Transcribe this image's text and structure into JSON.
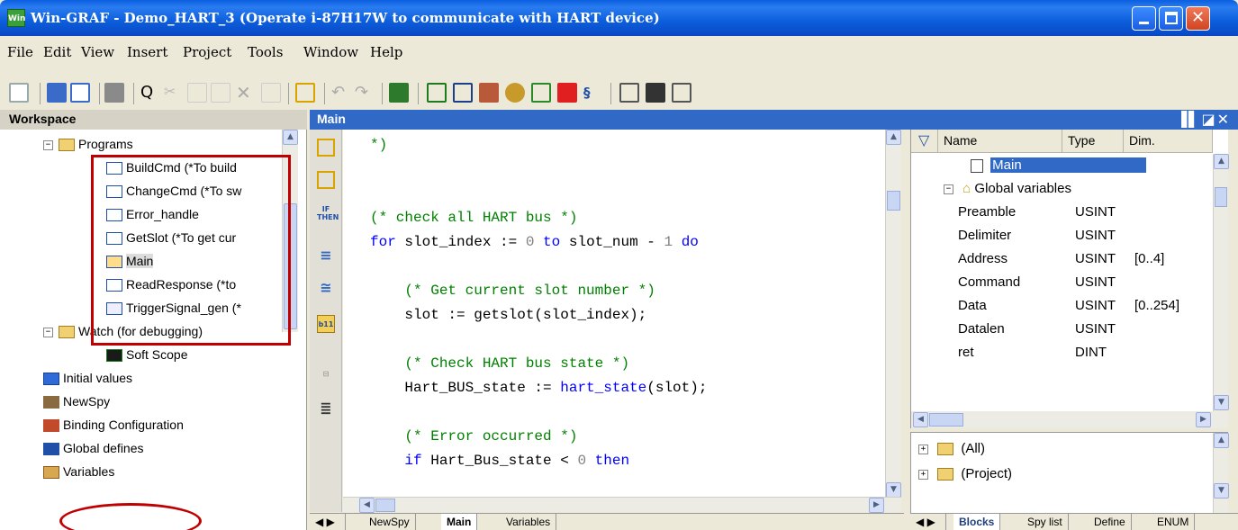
{
  "window": {
    "title": "Win-GRAF   - Demo_HART_3 (Operate i-87H17W to communicate with HART device)",
    "app_icon_label": "Win"
  },
  "menu": [
    "File",
    "Edit",
    "View",
    "Insert",
    "Project",
    "Tools",
    "Window",
    "Help"
  ],
  "workspace": {
    "title": "Workspace",
    "items": [
      {
        "label": "Programs",
        "type": "folder",
        "level": 1
      },
      {
        "label": "BuildCmd (*To build",
        "type": "program",
        "level": 2
      },
      {
        "label": "ChangeCmd (*To sw",
        "type": "program",
        "level": 2
      },
      {
        "label": "Error_handle",
        "type": "program",
        "level": 2
      },
      {
        "label": "GetSlot (*To get cur",
        "type": "program",
        "level": 2
      },
      {
        "label": "Main",
        "type": "st-main",
        "level": 2
      },
      {
        "label": "ReadResponse (*to",
        "type": "program",
        "level": 2
      },
      {
        "label": "TriggerSignal_gen (*",
        "type": "st",
        "level": 2
      },
      {
        "label": "Watch (for debugging)",
        "type": "folder",
        "level": 1
      },
      {
        "label": "Soft Scope",
        "type": "scope",
        "level": 2
      },
      {
        "label": "Initial values",
        "type": "table",
        "level": 1
      },
      {
        "label": "NewSpy",
        "type": "spy",
        "level": 1
      },
      {
        "label": "Binding Configuration",
        "type": "binding",
        "level": 1
      },
      {
        "label": "Global defines",
        "type": "defines",
        "level": 1
      },
      {
        "label": "Variables",
        "type": "variables",
        "level": 1
      }
    ]
  },
  "editor": {
    "title": "Main",
    "header_icons": "▐▌◪✕",
    "code": [
      {
        "parts": [
          {
            "t": "*)",
            "c": "cm"
          }
        ]
      },
      {
        "parts": []
      },
      {
        "parts": []
      },
      {
        "parts": [
          {
            "t": "(* check all HART bus *)",
            "c": "cm"
          }
        ]
      },
      {
        "parts": [
          {
            "t": "for",
            "c": "kw"
          },
          {
            "t": " slot_index := ",
            "c": ""
          },
          {
            "t": "0",
            "c": "num"
          },
          {
            "t": " to",
            "c": "kw"
          },
          {
            "t": " slot_num - ",
            "c": ""
          },
          {
            "t": "1",
            "c": "num"
          },
          {
            "t": " do",
            "c": "kw"
          }
        ]
      },
      {
        "parts": []
      },
      {
        "parts": [
          {
            "t": "    (* Get current slot number *)",
            "c": "cm"
          }
        ]
      },
      {
        "parts": [
          {
            "t": "    slot := getslot(slot_index);",
            "c": ""
          }
        ]
      },
      {
        "parts": []
      },
      {
        "parts": [
          {
            "t": "    (* Check HART bus state *)",
            "c": "cm"
          }
        ]
      },
      {
        "parts": [
          {
            "t": "    Hart_BUS_state := ",
            "c": ""
          },
          {
            "t": "hart_state",
            "c": "fn"
          },
          {
            "t": "(slot);",
            "c": ""
          }
        ]
      },
      {
        "parts": []
      },
      {
        "parts": [
          {
            "t": "    (* Error occurred *)",
            "c": "cm"
          }
        ]
      },
      {
        "parts": [
          {
            "t": "    if",
            "c": "kw"
          },
          {
            "t": " Hart_Bus_state < ",
            "c": ""
          },
          {
            "t": "0",
            "c": "num"
          },
          {
            "t": " then",
            "c": "kw"
          }
        ]
      }
    ],
    "tabs": [
      "NewSpy",
      "Main",
      "Variables"
    ],
    "active_tab": "Main"
  },
  "variables": {
    "columns": [
      "Name",
      "Type",
      "Dim."
    ],
    "main_label": "Main",
    "group_label": "Global variables",
    "rows": [
      {
        "name": "Preamble",
        "type": "USINT",
        "dim": ""
      },
      {
        "name": "Delimiter",
        "type": "USINT",
        "dim": ""
      },
      {
        "name": "Address",
        "type": "USINT",
        "dim": "[0..4]"
      },
      {
        "name": "Command",
        "type": "USINT",
        "dim": ""
      },
      {
        "name": "Data",
        "type": "USINT",
        "dim": "[0..254]"
      },
      {
        "name": "Datalen",
        "type": "USINT",
        "dim": ""
      },
      {
        "name": "ret",
        "type": "DINT",
        "dim": ""
      }
    ]
  },
  "library": {
    "items": [
      "(All)",
      "(Project)"
    ],
    "tabs": [
      "Blocks",
      "Spy list",
      "Define",
      "ENUM"
    ],
    "active_tab": "Blocks"
  },
  "gutter_labels": {
    "if_then": "IF THEN",
    "b11": "b11"
  },
  "colors": {
    "title_bar": "#0a5fe0",
    "panel_header": "#3169c6",
    "highlight": "#c00000",
    "selection": "#3169c6"
  }
}
